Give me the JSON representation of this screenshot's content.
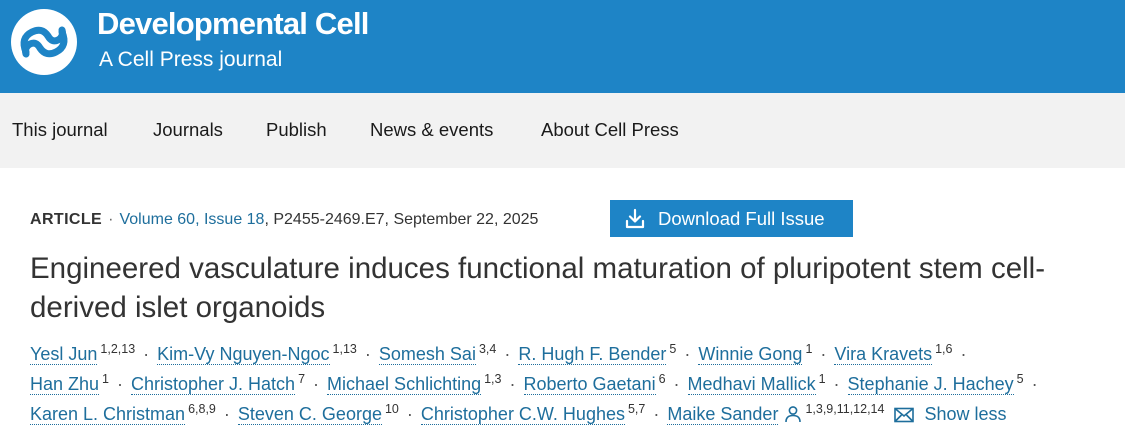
{
  "brand": {
    "title": "Developmental Cell",
    "subtitle": "A Cell Press journal",
    "color": "#1e84c6"
  },
  "nav": {
    "items": [
      "This journal",
      "Journals",
      "Publish",
      "News & events",
      "About Cell Press"
    ]
  },
  "meta": {
    "type": "ARTICLE",
    "volume_issue": "Volume 60, Issue 18",
    "pages_date": ", P2455-2469.E7, September 22, 2025"
  },
  "download_button": {
    "label": "Download Full Issue",
    "icon": "download-icon"
  },
  "title": "Engineered vasculature induces functional maturation of pluripotent stem cell-derived islet organoids",
  "authors": [
    {
      "name": "Yesl Jun",
      "aff": "1,2,13"
    },
    {
      "name": "Kim-Vy Nguyen-Ngoc",
      "aff": "1,13"
    },
    {
      "name": "Somesh Sai",
      "aff": "3,4"
    },
    {
      "name": "R. Hugh F. Bender",
      "aff": "5"
    },
    {
      "name": "Winnie Gong",
      "aff": "1"
    },
    {
      "name": "Vira Kravets",
      "aff": "1,6"
    },
    {
      "name": "Han Zhu",
      "aff": "1"
    },
    {
      "name": "Christopher J. Hatch",
      "aff": "7"
    },
    {
      "name": "Michael Schlichting",
      "aff": "1,3"
    },
    {
      "name": "Roberto Gaetani",
      "aff": "6"
    },
    {
      "name": "Medhavi Mallick",
      "aff": "1"
    },
    {
      "name": "Stephanie J. Hachey",
      "aff": "5"
    },
    {
      "name": "Karen L. Christman",
      "aff": "6,8,9"
    },
    {
      "name": "Steven C. George",
      "aff": "10"
    },
    {
      "name": "Christopher C.W. Hughes",
      "aff": "5,7"
    },
    {
      "name": "Maike Sander",
      "aff": "1,3,9,11,12,14",
      "icons": [
        "person-icon",
        "email-icon"
      ]
    }
  ],
  "show_less_label": "Show less"
}
